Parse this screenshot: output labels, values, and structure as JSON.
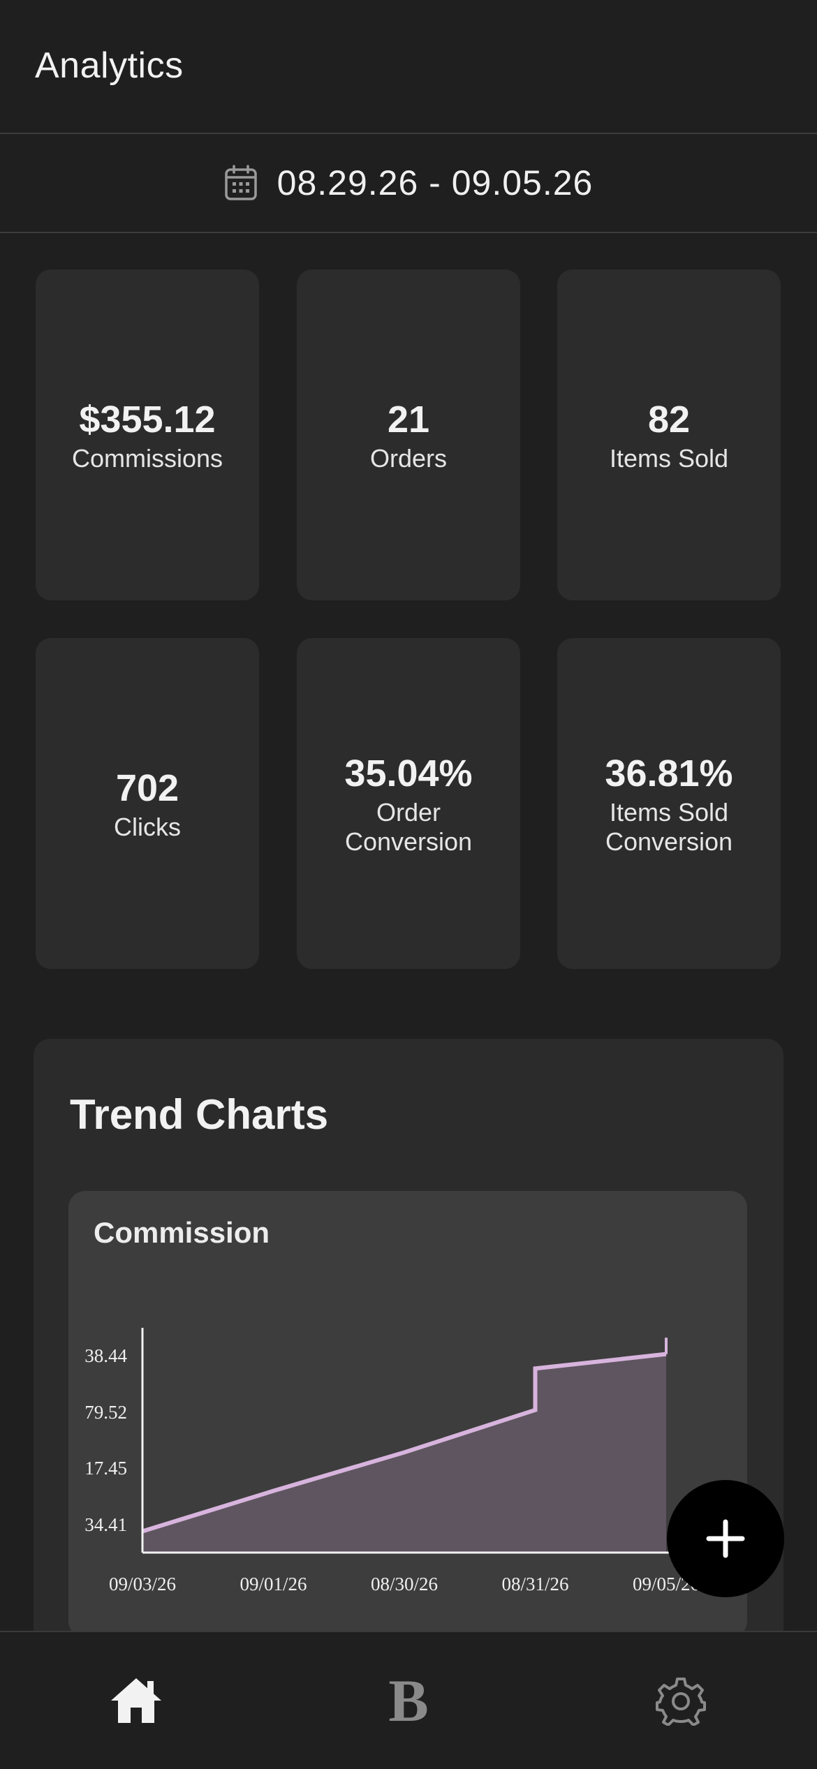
{
  "header": {
    "title": "Analytics"
  },
  "date_range": {
    "label": "08.29.26 - 09.05.26",
    "icon": "calendar-icon"
  },
  "stats": [
    {
      "value": "$355.12",
      "label": "Commissions"
    },
    {
      "value": "21",
      "label": "Orders"
    },
    {
      "value": "82",
      "label": "Items Sold"
    },
    {
      "value": "702",
      "label": "Clicks"
    },
    {
      "value": "35.04%",
      "label": "Order Conversion"
    },
    {
      "value": "36.81%",
      "label": "Items Sold Conversion"
    }
  ],
  "trend": {
    "title": "Trend Charts",
    "chart_title": "Commission"
  },
  "chart_data": {
    "type": "area",
    "title": "Commission",
    "categories": [
      "09/03/26",
      "09/01/26",
      "08/30/26",
      "08/31/26",
      "09/05/26"
    ],
    "y_tick_labels": [
      "38.44",
      "79.52",
      "17.45",
      "34.41"
    ],
    "series": [
      {
        "values": [
          34.41,
          38.6,
          42.6,
          47.0,
          52.8
        ]
      }
    ],
    "step_at": {
      "category": "08/31/26",
      "from": 47.0,
      "to": 51.3
    },
    "end_spike": 54.5,
    "ylim": [
      32.2,
      55.6
    ],
    "grid": false,
    "colors": {
      "line": "#d7b4dd",
      "fill": "#5f5560",
      "axis": "#f2f2f2"
    }
  },
  "nav": [
    {
      "icon": "home-icon"
    },
    {
      "icon": "brand-b-icon",
      "text": "B"
    },
    {
      "icon": "gear-icon"
    }
  ],
  "fab": {
    "icon": "plus-icon"
  }
}
